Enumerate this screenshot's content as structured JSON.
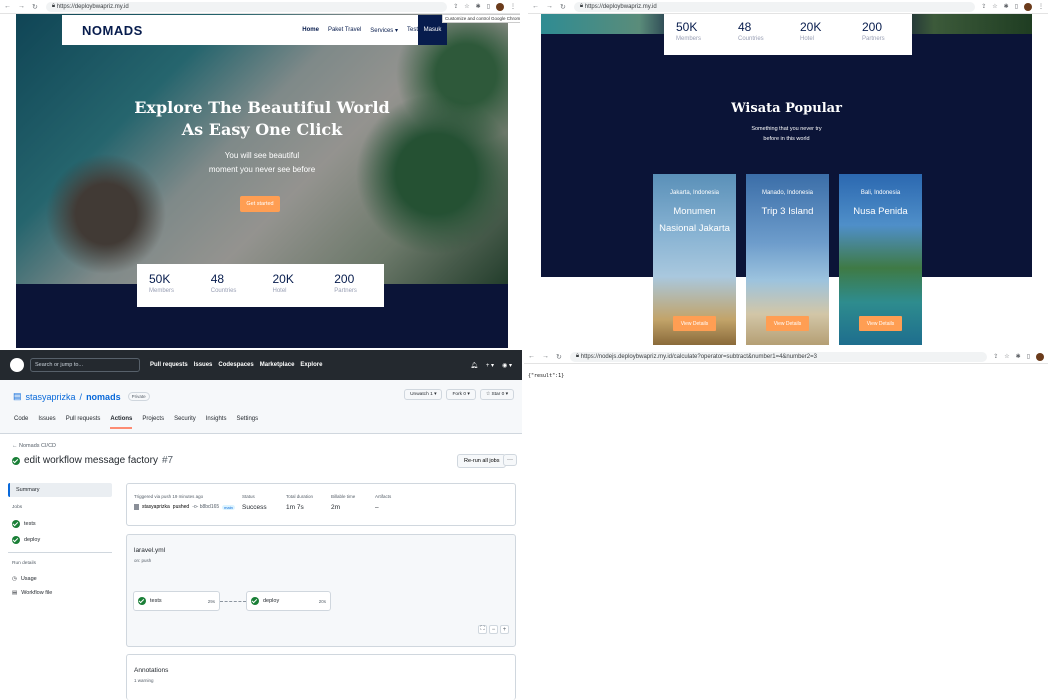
{
  "q1": {
    "url": "https://deploybwapriz.my.id",
    "tooltip": "Customize and control Google Chrome",
    "logo": "NOMADS",
    "menu": [
      "Home",
      "Paket Travel",
      "Services ▾",
      "Testimonial"
    ],
    "login": "Masuk",
    "hero_title_1": "Explore The Beautiful World",
    "hero_title_2": "As Easy One Click",
    "hero_sub_1": "You will see beautiful",
    "hero_sub_2": "moment you never see before",
    "cta": "Get started",
    "stats": [
      {
        "num": "50K",
        "label": "Members"
      },
      {
        "num": "48",
        "label": "Countries"
      },
      {
        "num": "20K",
        "label": "Hotel"
      },
      {
        "num": "200",
        "label": "Partners"
      }
    ]
  },
  "q2": {
    "url": "https://deploybwapriz.my.id",
    "stats": [
      {
        "num": "50K",
        "label": "Members"
      },
      {
        "num": "48",
        "label": "Countries"
      },
      {
        "num": "20K",
        "label": "Hotel"
      },
      {
        "num": "200",
        "label": "Partners"
      }
    ],
    "title": "Wisata Popular",
    "sub_1": "Something that you never try",
    "sub_2": "before in this world",
    "cards": [
      {
        "country": "Jakarta, Indonesia",
        "name": "Monumen Nasional Jakarta",
        "button": "View Details"
      },
      {
        "country": "Manado, Indonesia",
        "name": "Trip 3 Island",
        "button": "View Details"
      },
      {
        "country": "Bali, Indonesia",
        "name": "Nusa Penida",
        "button": "View Details"
      }
    ]
  },
  "q3": {
    "search": "Search or jump to...",
    "top_links": [
      "Pull requests",
      "Issues",
      "Codespaces",
      "Marketplace",
      "Explore"
    ],
    "owner": "stasyaprizka",
    "repo": "nomads",
    "private": "Private",
    "actions": [
      "Unwatch 1 ▾",
      "Fork 0 ▾",
      "☆ Star 0 ▾"
    ],
    "tabs": [
      "Code",
      "Issues",
      "Pull requests",
      "Actions",
      "Projects",
      "Security",
      "Insights",
      "Settings"
    ],
    "crumb": "← Nomads CI/CD",
    "run_title": "edit workflow message factory",
    "run_num": "#7",
    "rerun": "Re-run all jobs",
    "more": "···",
    "sidebar": {
      "summary": "Summary",
      "jobs_hdr": "Jobs",
      "jobs": [
        "tests",
        "deploy"
      ],
      "details_hdr": "Run details",
      "details": [
        "Usage",
        "Workflow file"
      ]
    },
    "summary_panel": {
      "trigger": "Triggered via push 19 minutes ago",
      "user": "stasyaprizka",
      "pushed": "pushed",
      "sha": "-o- b8bd165",
      "branch": "main",
      "status_h": "Status",
      "status_v": "Success",
      "duration_h": "Total duration",
      "duration_v": "1m 7s",
      "billable_h": "Billable time",
      "billable_v": "2m",
      "artifacts_h": "Artifacts",
      "artifacts_v": "–"
    },
    "workflow": {
      "file": "laravel.yml",
      "trigger": "on: push",
      "jobs": [
        {
          "name": "tests",
          "dur": "29s"
        },
        {
          "name": "deploy",
          "dur": "20s"
        }
      ]
    },
    "annotations": {
      "title": "Annotations",
      "sub": "1 warning"
    }
  },
  "q4": {
    "url": "https://nodejs.deploybwapriz.my.id/calculate?operator=subtract&number1=4&number2=3",
    "body": "{\"result\":1}"
  }
}
